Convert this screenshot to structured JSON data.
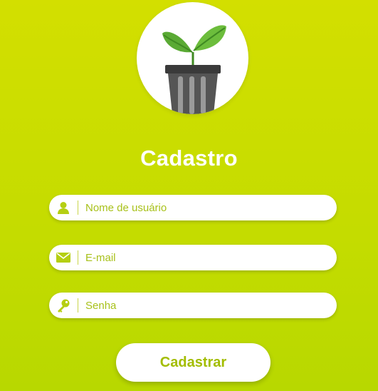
{
  "logo": {
    "icon": "plant-pot-icon"
  },
  "title": "Cadastro",
  "fields": {
    "username": {
      "placeholder": "Nome de usuário",
      "value": "",
      "icon": "user-icon"
    },
    "email": {
      "placeholder": "E-mail",
      "value": "",
      "icon": "envelope-icon"
    },
    "password": {
      "placeholder": "Senha",
      "value": "",
      "icon": "key-icon"
    }
  },
  "submit_label": "Cadastrar",
  "colors": {
    "background_top": "#d3df00",
    "background_bottom": "#b8d800",
    "accent": "#a3bd00",
    "icon_fill": "#b5cf12",
    "leaf_green": "#5aaa34",
    "pot_dark": "#4a4a4a"
  }
}
